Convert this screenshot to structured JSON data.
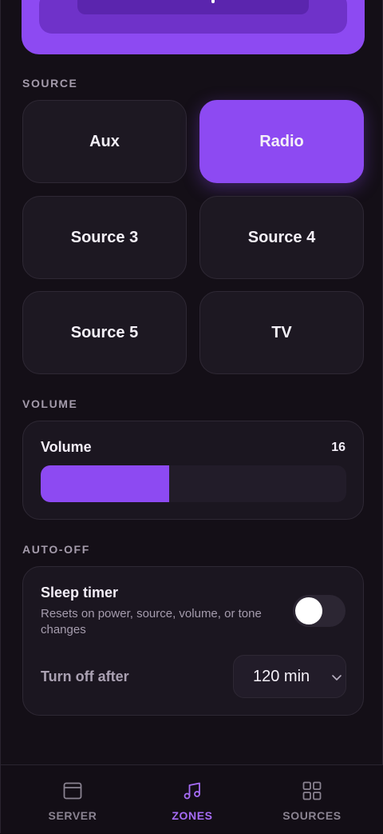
{
  "sections": {
    "source": "SOURCE",
    "volume": "VOLUME",
    "auto_off": "AUTO-OFF"
  },
  "sources": [
    {
      "label": "Aux",
      "active": false
    },
    {
      "label": "Radio",
      "active": true
    },
    {
      "label": "Source 3",
      "active": false
    },
    {
      "label": "Source 4",
      "active": false
    },
    {
      "label": "Source 5",
      "active": false
    },
    {
      "label": "TV",
      "active": false
    }
  ],
  "volume": {
    "title": "Volume",
    "value": "16",
    "level_fraction": 0.42
  },
  "auto_off": {
    "sleep_title": "Sleep timer",
    "sleep_desc": "Resets on power, source, volume, or tone changes",
    "sleep_enabled": false,
    "turn_off_label": "Turn off after",
    "turn_off_value": "120 min"
  },
  "nav": [
    {
      "label": "SERVER",
      "icon": "window-icon",
      "active": false
    },
    {
      "label": "ZONES",
      "icon": "music-note-icon",
      "active": true
    },
    {
      "label": "SOURCES",
      "icon": "grid-icon",
      "active": false
    }
  ],
  "colors": {
    "accent": "#8d4af2",
    "background": "#140f17",
    "card": "#1b1620",
    "nav_active": "#a66cf6"
  }
}
